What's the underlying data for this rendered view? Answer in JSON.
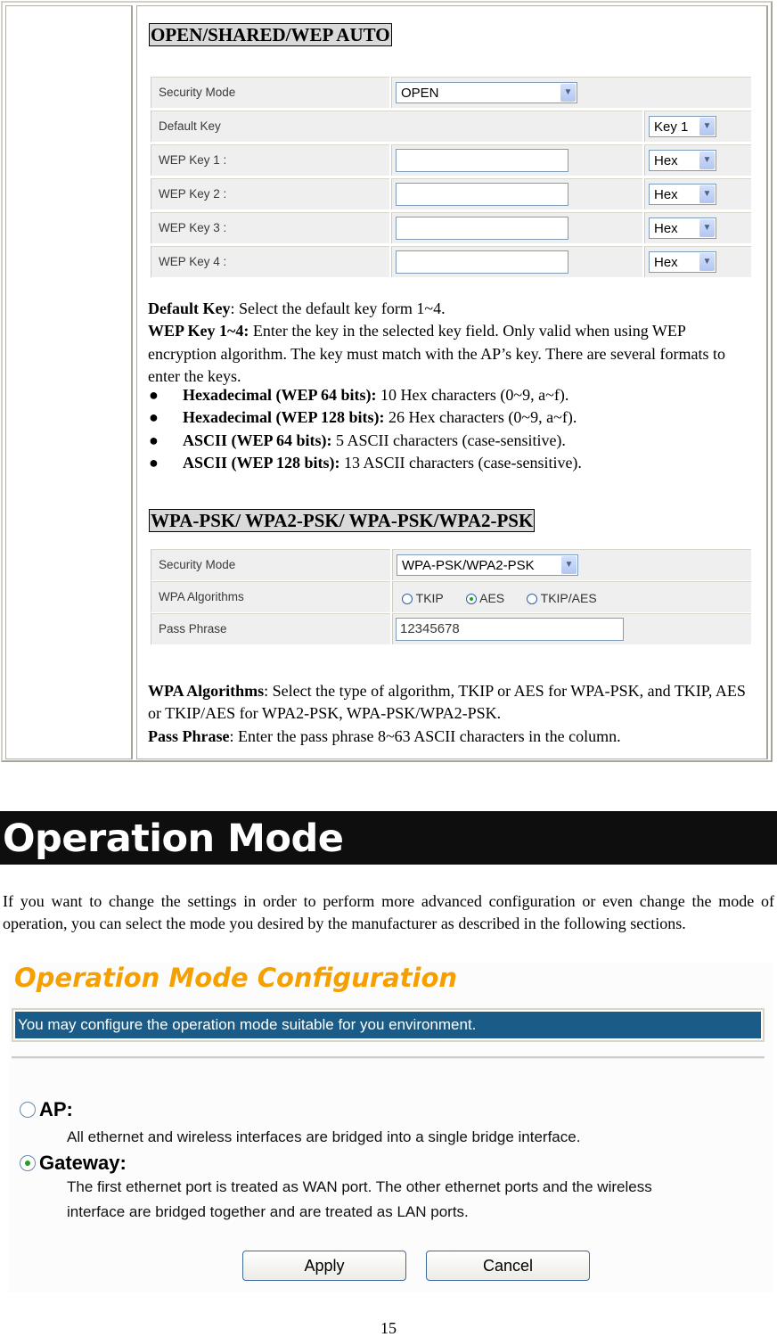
{
  "wep_section": {
    "heading": "OPEN/SHARED/WEP AUTO",
    "rows": [
      {
        "label": "Security Mode",
        "control": "select",
        "value": "OPEN"
      },
      {
        "label": "Default Key",
        "control": "select",
        "value": "Key 1"
      },
      {
        "label": "WEP Key 1 :",
        "input_value": "",
        "format": "Hex"
      },
      {
        "label": "WEP Key 2 :",
        "input_value": "",
        "format": "Hex"
      },
      {
        "label": "WEP Key 3 :",
        "input_value": "",
        "format": "Hex"
      },
      {
        "label": "WEP Key 4 :",
        "input_value": "",
        "format": "Hex"
      }
    ],
    "desc": {
      "default_key_term": "Default Key",
      "default_key_text": ": Select the default key form 1~4.",
      "wep_key_term": "WEP Key 1~4:",
      "wep_key_text": " Enter the key in the selected key field. Only valid when using WEP encryption algorithm. The key must match with the AP’s key. There are several formats to enter the keys."
    },
    "bullets": [
      {
        "term": "Hexadecimal (WEP 64 bits):",
        "text": " 10 Hex characters (0~9, a~f)."
      },
      {
        "term": "Hexadecimal (WEP 128 bits):",
        "text": " 26 Hex characters (0~9, a~f)."
      },
      {
        "term": "ASCII (WEP 64 bits):",
        "text": " 5 ASCII characters (case-sensitive)."
      },
      {
        "term": "ASCII (WEP 128 bits):",
        "text": " 13 ASCII characters (case-sensitive)."
      }
    ]
  },
  "wpa_section": {
    "heading": "WPA-PSK/ WPA2-PSK/ WPA-PSK/WPA2-PSK",
    "security_mode_label": "Security Mode",
    "security_mode_value": "WPA-PSK/WPA2-PSK",
    "algorithms_label": "WPA Algorithms",
    "algorithms": [
      {
        "label": "TKIP",
        "selected": false
      },
      {
        "label": "AES",
        "selected": true
      },
      {
        "label": "TKIP/AES",
        "selected": false
      }
    ],
    "pass_phrase_label": "Pass Phrase",
    "pass_phrase_value": "12345678",
    "desc": {
      "algo_term": "WPA Algorithms",
      "algo_text": ": Select the type of algorithm, TKIP or AES for WPA-PSK, and TKIP, AES or TKIP/AES for WPA2-PSK, WPA-PSK/WPA2-PSK.",
      "pass_term": "Pass Phrase",
      "pass_text": ": Enter the pass phrase 8~63 ASCII characters in the column."
    }
  },
  "operation_mode": {
    "heading": "Operation Mode",
    "intro": "If you want to change the settings in order to perform more advanced configuration or even change the mode of operation, you can select the mode you desired by the manufacturer as described in the following sections.",
    "screenshot": {
      "title": "Operation Mode Configuration",
      "banner": "You may configure the operation mode suitable for you environment.",
      "options": [
        {
          "label": "AP:",
          "selected": false,
          "description": "All ethernet and wireless interfaces are bridged into a single bridge interface."
        },
        {
          "label": "Gateway:",
          "selected": true,
          "description_line1": "The first ethernet port is treated as WAN port. The other ethernet ports and the wireless",
          "description_line2": "interface are bridged together and are treated as LAN ports."
        }
      ],
      "apply_label": "Apply",
      "cancel_label": "Cancel"
    }
  },
  "page_number": "15"
}
